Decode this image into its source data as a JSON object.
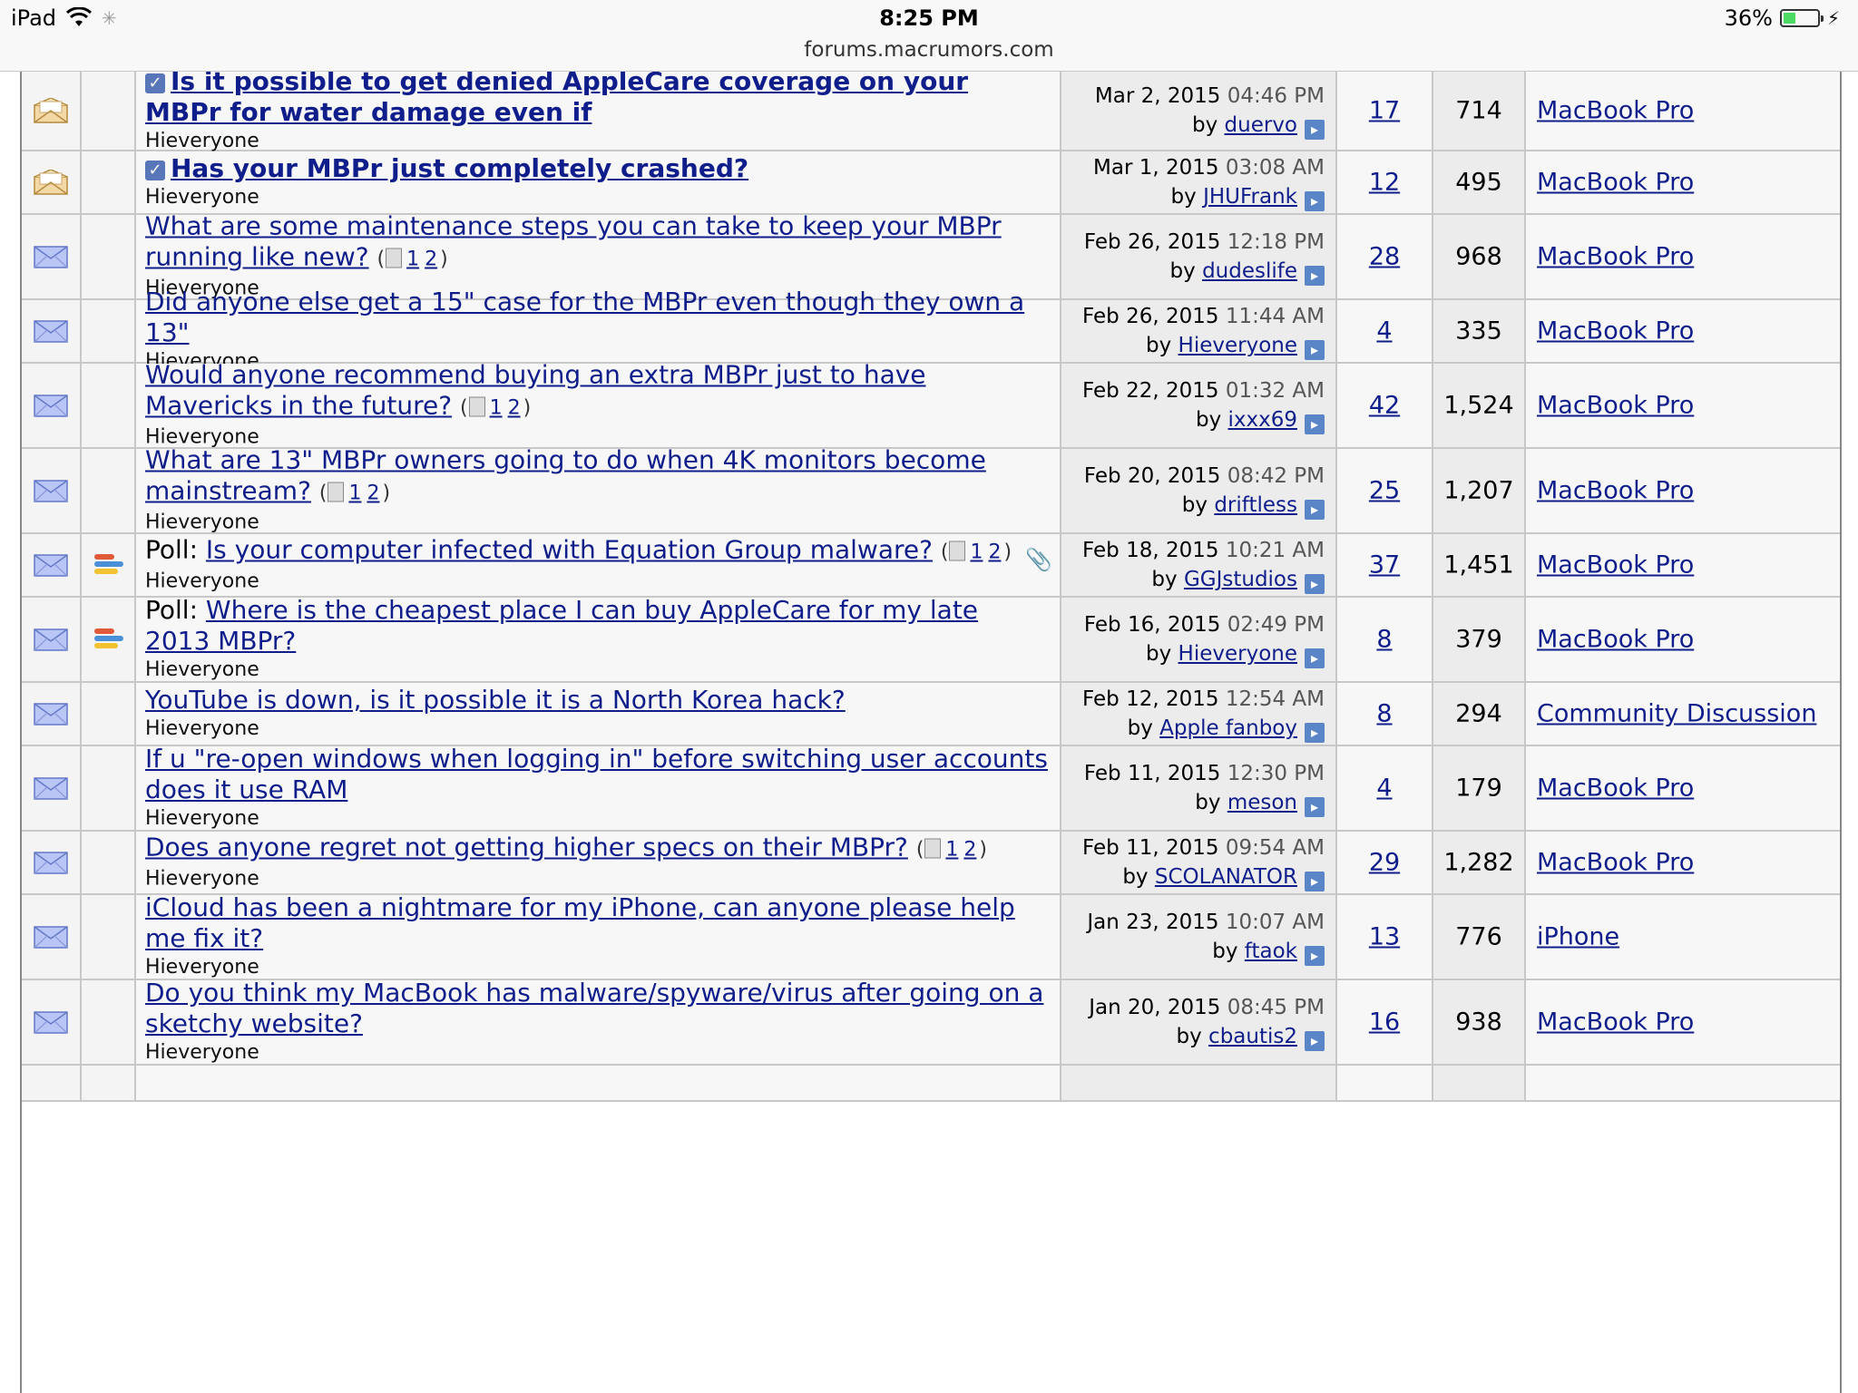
{
  "status_bar": {
    "device": "iPad",
    "time": "8:25 PM",
    "url": "forums.macrumors.com",
    "battery": "36%",
    "battery_level": 0.36
  },
  "threads": [
    {
      "title": "Is it possible to get denied AppleCare coverage on your MBPr for water damage even if",
      "bold": true,
      "checked": true,
      "prefix": "",
      "pages": [],
      "author": "Hieveryone",
      "date": "Mar 2, 2015",
      "time": "04:46 PM",
      "last_by": "duervo",
      "replies": "17",
      "views": "714",
      "forum": "MacBook Pro",
      "icon": "envelope-open-icon",
      "poll": false,
      "attachment": false
    },
    {
      "title": "Has your MBPr just completely crashed?",
      "bold": true,
      "checked": true,
      "prefix": "",
      "pages": [],
      "author": "Hieveryone",
      "date": "Mar 1, 2015",
      "time": "03:08 AM",
      "last_by": "JHUFrank",
      "replies": "12",
      "views": "495",
      "forum": "MacBook Pro",
      "icon": "envelope-open-icon",
      "poll": false,
      "attachment": false
    },
    {
      "title": "What are some maintenance steps you can take to keep your MBPr running like new?",
      "bold": false,
      "checked": false,
      "prefix": "",
      "pages": [
        "1",
        "2"
      ],
      "author": "Hieveryone",
      "date": "Feb 26, 2015",
      "time": "12:18 PM",
      "last_by": "dudeslife",
      "replies": "28",
      "views": "968",
      "forum": "MacBook Pro",
      "icon": "envelope-icon",
      "poll": false,
      "attachment": false
    },
    {
      "title": "Did anyone else get a 15\" case for the MBPr even though they own a 13\"",
      "bold": false,
      "checked": false,
      "prefix": "",
      "pages": [],
      "author": "Hieveryone",
      "date": "Feb 26, 2015",
      "time": "11:44 AM",
      "last_by": "Hieveryone",
      "replies": "4",
      "views": "335",
      "forum": "MacBook Pro",
      "icon": "envelope-icon",
      "poll": false,
      "attachment": false
    },
    {
      "title": "Would anyone recommend buying an extra MBPr just to have Mavericks in the future?",
      "bold": false,
      "checked": false,
      "prefix": "",
      "pages": [
        "1",
        "2"
      ],
      "author": "Hieveryone",
      "date": "Feb 22, 2015",
      "time": "01:32 AM",
      "last_by": "ixxx69",
      "replies": "42",
      "views": "1,524",
      "forum": "MacBook Pro",
      "icon": "envelope-icon",
      "poll": false,
      "attachment": false
    },
    {
      "title": "What are 13\" MBPr owners going to do when 4K monitors become mainstream?",
      "bold": false,
      "checked": false,
      "prefix": "",
      "pages": [
        "1",
        "2"
      ],
      "author": "Hieveryone",
      "date": "Feb 20, 2015",
      "time": "08:42 PM",
      "last_by": "driftless",
      "replies": "25",
      "views": "1,207",
      "forum": "MacBook Pro",
      "icon": "envelope-icon",
      "poll": false,
      "attachment": false
    },
    {
      "title": "Is your computer infected with Equation Group malware?",
      "bold": false,
      "checked": false,
      "prefix": "Poll: ",
      "pages": [
        "1",
        "2"
      ],
      "author": "Hieveryone",
      "date": "Feb 18, 2015",
      "time": "10:21 AM",
      "last_by": "GGJstudios",
      "replies": "37",
      "views": "1,451",
      "forum": "MacBook Pro",
      "icon": "envelope-icon",
      "poll": true,
      "attachment": true
    },
    {
      "title": "Where is the cheapest place I can buy AppleCare for my late 2013 MBPr?",
      "bold": false,
      "checked": false,
      "prefix": "Poll: ",
      "pages": [],
      "author": "Hieveryone",
      "date": "Feb 16, 2015",
      "time": "02:49 PM",
      "last_by": "Hieveryone",
      "replies": "8",
      "views": "379",
      "forum": "MacBook Pro",
      "icon": "envelope-icon",
      "poll": true,
      "attachment": false
    },
    {
      "title": "YouTube is down, is it possible it is a North Korea hack?",
      "bold": false,
      "checked": false,
      "prefix": "",
      "pages": [],
      "author": "Hieveryone",
      "date": "Feb 12, 2015",
      "time": "12:54 AM",
      "last_by": "Apple fanboy",
      "replies": "8",
      "views": "294",
      "forum": "Community Discussion",
      "icon": "envelope-icon",
      "poll": false,
      "attachment": false
    },
    {
      "title": "If u \"re-open windows when logging in\" before switching user accounts does it use RAM",
      "bold": false,
      "checked": false,
      "prefix": "",
      "pages": [],
      "author": "Hieveryone",
      "date": "Feb 11, 2015",
      "time": "12:30 PM",
      "last_by": "meson",
      "replies": "4",
      "views": "179",
      "forum": "MacBook Pro",
      "icon": "envelope-icon",
      "poll": false,
      "attachment": false
    },
    {
      "title": "Does anyone regret not getting higher specs on their MBPr?",
      "bold": false,
      "checked": false,
      "prefix": "",
      "pages": [
        "1",
        "2"
      ],
      "author": "Hieveryone",
      "date": "Feb 11, 2015",
      "time": "09:54 AM",
      "last_by": "SCOLANATOR",
      "replies": "29",
      "views": "1,282",
      "forum": "MacBook Pro",
      "icon": "envelope-icon",
      "poll": false,
      "attachment": false
    },
    {
      "title": "iCloud has been a nightmare for my iPhone, can anyone please help me fix it?",
      "bold": false,
      "checked": false,
      "prefix": "",
      "pages": [],
      "author": "Hieveryone",
      "date": "Jan 23, 2015",
      "time": "10:07 AM",
      "last_by": "ftaok",
      "replies": "13",
      "views": "776",
      "forum": "iPhone",
      "icon": "envelope-icon",
      "poll": false,
      "attachment": false
    },
    {
      "title": "Do you think my MacBook has malware/spyware/virus after going on a sketchy website?",
      "bold": false,
      "checked": false,
      "prefix": "",
      "pages": [],
      "author": "Hieveryone",
      "date": "Jan 20, 2015",
      "time": "08:45 PM",
      "last_by": "cbautis2",
      "replies": "16",
      "views": "938",
      "forum": "MacBook Pro",
      "icon": "envelope-icon",
      "poll": false,
      "attachment": false
    }
  ],
  "labels": {
    "by": "by"
  },
  "colors": {
    "link": "#101e8c",
    "accent": "#5a86c8"
  }
}
